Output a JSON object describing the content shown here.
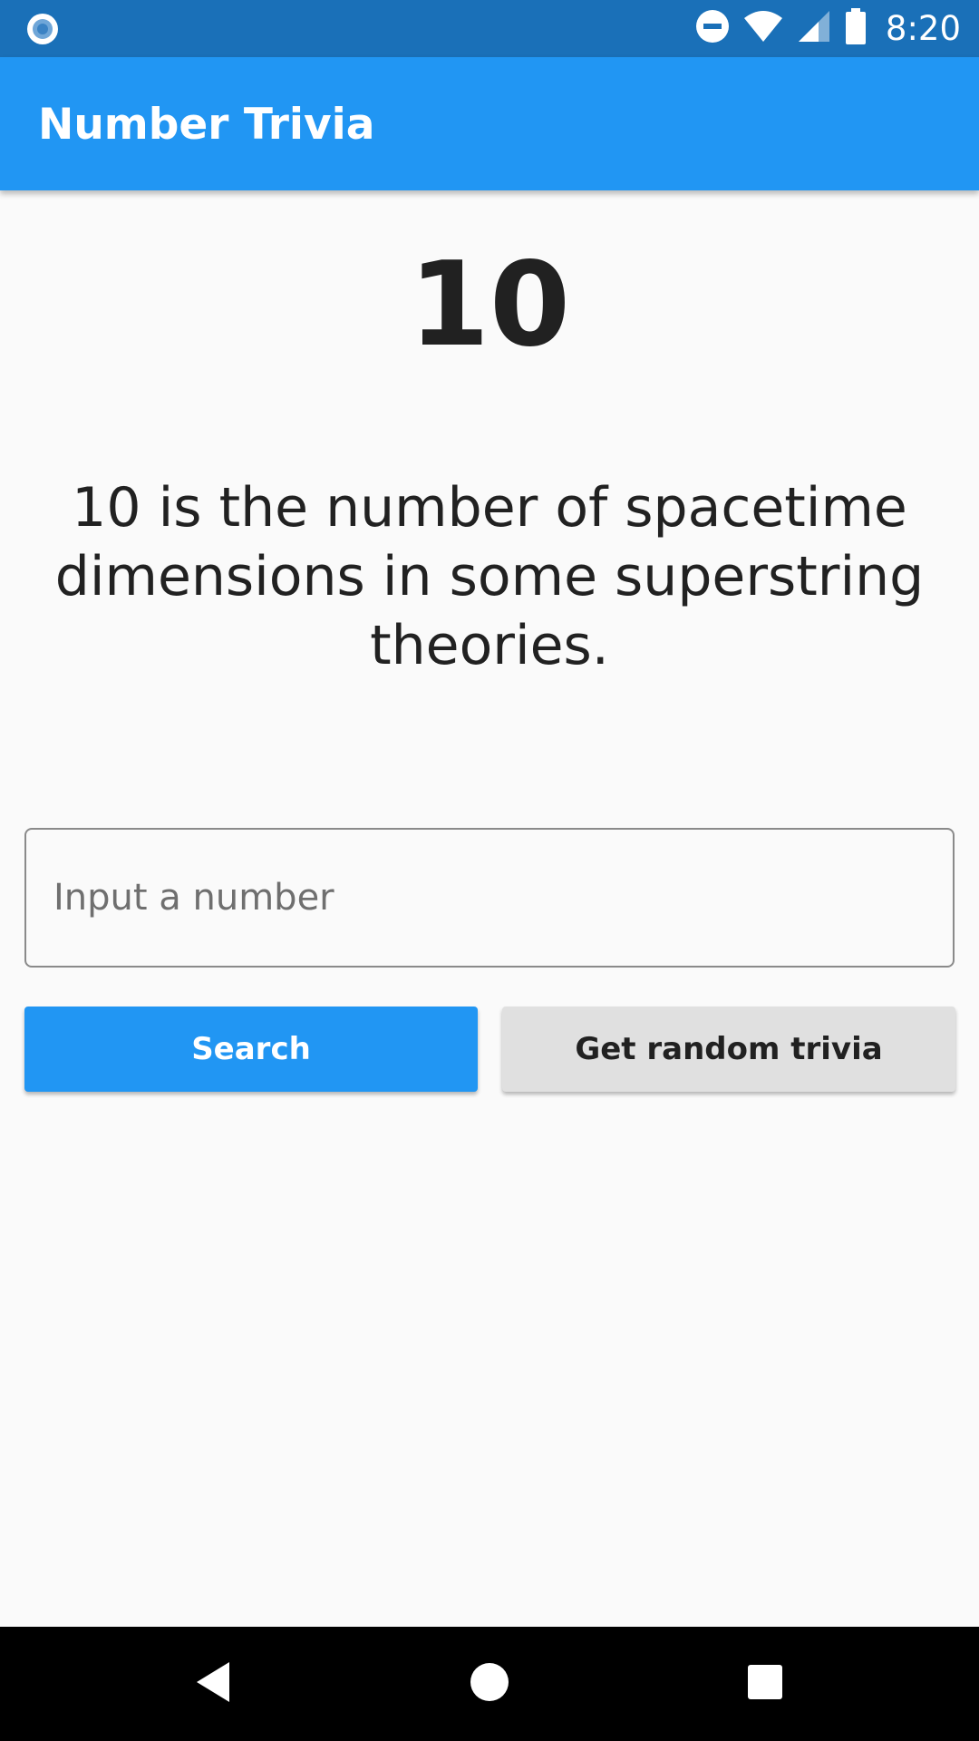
{
  "status_bar": {
    "time": "8:20",
    "icons": [
      "notification-dot-icon",
      "do-not-disturb-icon",
      "wifi-icon",
      "cellular-signal-icon",
      "battery-icon"
    ],
    "background": "#1a70b8"
  },
  "app_bar": {
    "title": "Number Trivia",
    "background": "#2196f3"
  },
  "trivia": {
    "number": "10",
    "text": "10 is the number of spacetime dimensions in some superstring theories."
  },
  "input": {
    "value": "",
    "placeholder": "Input a number"
  },
  "buttons": {
    "search_label": "Search",
    "random_label": "Get random trivia"
  },
  "nav_bar": {
    "icons": [
      "back-icon",
      "home-icon",
      "recents-icon"
    ]
  },
  "colors": {
    "primary": "#2196f3",
    "text": "#212121",
    "background": "#fafafa",
    "secondary_button": "#e0e0e0"
  }
}
